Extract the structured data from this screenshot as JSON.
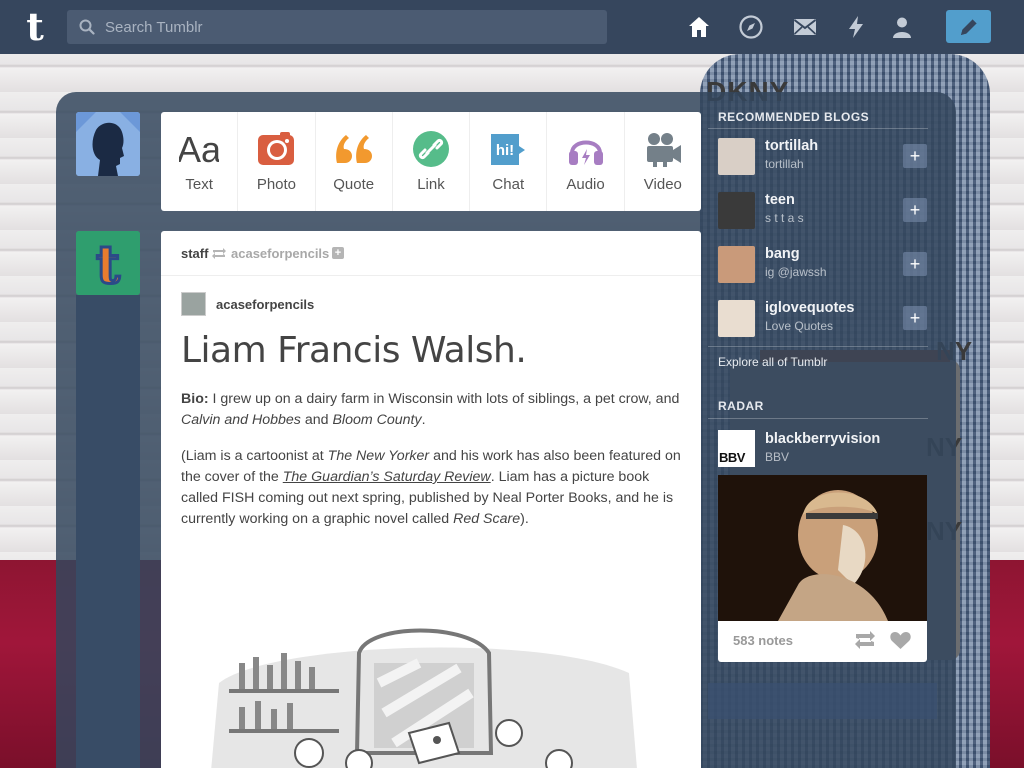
{
  "header": {
    "logo": "t",
    "search_placeholder": "Search Tumblr",
    "nav_icons": [
      "home-icon",
      "explore-icon",
      "messages-icon",
      "activity-icon",
      "account-icon"
    ],
    "compose_icon": "pencil-icon",
    "colors": {
      "bar": "#36465d",
      "compose": "#529ecc"
    }
  },
  "post_types": [
    {
      "label": "Text",
      "icon": "text-icon",
      "color": "#444444"
    },
    {
      "label": "Photo",
      "icon": "photo-icon",
      "color": "#d95e40"
    },
    {
      "label": "Quote",
      "icon": "quote-icon",
      "color": "#f2992e"
    },
    {
      "label": "Link",
      "icon": "link-icon",
      "color": "#56bc8a"
    },
    {
      "label": "Chat",
      "icon": "chat-icon",
      "color": "#529ecc"
    },
    {
      "label": "Audio",
      "icon": "audio-icon",
      "color": "#a77dc2"
    },
    {
      "label": "Video",
      "icon": "video-icon",
      "color": "#748089"
    }
  ],
  "post": {
    "author": "staff",
    "reblogged_from": "acaseforpencils",
    "source_name": "acaseforpencils",
    "title": "Liam Francis Walsh.",
    "bio_label": "Bio:",
    "bio_text_1": " I grew up on a dairy farm in Wisconsin with lots of siblings, a pet crow, and ",
    "bio_italic_1": "Calvin and Hobbes",
    "bio_text_2": " and ",
    "bio_italic_2": "Bloom County",
    "bio_text_3": ".",
    "p2_text_1": "(Liam is a cartoonist at ",
    "p2_italic_1": "The New Yorker",
    "p2_text_2": " and his work has also been featured on the cover of the ",
    "p2_link": "The Guardian’s Saturday Review",
    "p2_text_3": ". Liam has a picture book called FISH coming out next spring, published by Neal Porter Books, and he is currently working on a graphic novel called ",
    "p2_italic_2": "Red Scare",
    "p2_text_4": ")."
  },
  "sidebar": {
    "recommended_heading": "RECOMMENDED BLOGS",
    "recommended": [
      {
        "name": "tortillah",
        "sub": "tortillah"
      },
      {
        "name": "teen",
        "sub": "s t t a s"
      },
      {
        "name": "bang",
        "sub": "ig @jawssh"
      },
      {
        "name": "iglovequotes",
        "sub": "Love Quotes"
      }
    ],
    "explore_label": "Explore all of Tumblr",
    "radar_heading": "RADAR",
    "radar": {
      "name": "blackberryvision",
      "sub": "BBV",
      "thumb_text": "BBV",
      "notes": "583 notes"
    }
  }
}
